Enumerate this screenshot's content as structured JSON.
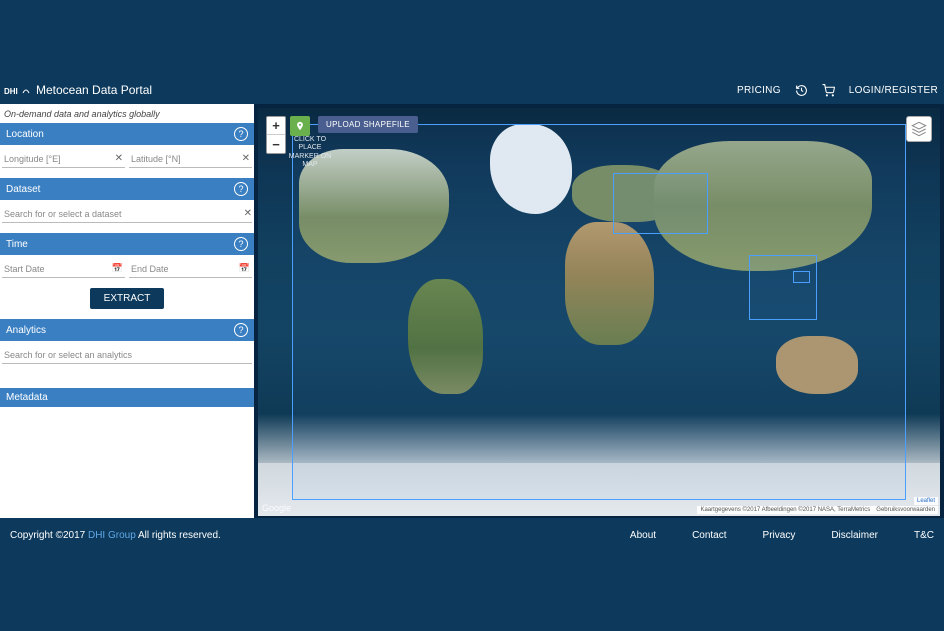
{
  "header": {
    "title": "Metocean Data Portal",
    "pricing": "PRICING",
    "login": "LOGIN/REGISTER"
  },
  "sidebar": {
    "tagline": "On-demand data and analytics globally",
    "location": {
      "title": "Location",
      "lon_placeholder": "Longitude [°E]",
      "lat_placeholder": "Latitude [°N]"
    },
    "dataset": {
      "title": "Dataset",
      "placeholder": "Search for or select a dataset"
    },
    "time": {
      "title": "Time",
      "start_placeholder": "Start Date",
      "end_placeholder": "End Date"
    },
    "extract_label": "EXTRACT",
    "analytics": {
      "title": "Analytics",
      "placeholder": "Search for or select an analytics"
    },
    "metadata": {
      "title": "Metadata"
    }
  },
  "map": {
    "marker_hint": "CLICK TO PLACE MARKER ON MAP",
    "upload_label": "UPLOAD SHAPEFILE",
    "google": "Google",
    "leaflet": "Leaflet",
    "attribution_1": "Kaartgegevens ©2017 Afbeeldingen ©2017 NASA, TerraMetrics",
    "attribution_2": "Gebruiksvoorwaarden"
  },
  "footer": {
    "copyright_prefix": "Copyright ©2017 ",
    "dhi": "DHI Group",
    "copyright_suffix": " All rights reserved.",
    "links": {
      "about": "About",
      "contact": "Contact",
      "privacy": "Privacy",
      "disclaimer": "Disclaimer",
      "tc": "T&C"
    }
  }
}
